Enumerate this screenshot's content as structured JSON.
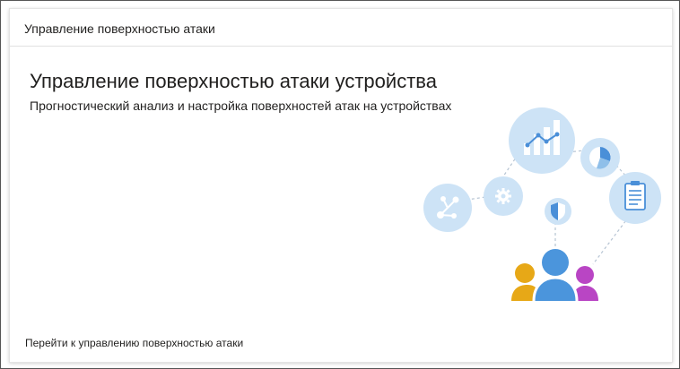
{
  "card": {
    "title": "Управление поверхностью атаки"
  },
  "hero": {
    "title": "Управление поверхностью атаки устройства",
    "subtitle": "Прогностический анализ и настройка поверхностей атак на устройствах"
  },
  "footer": {
    "link_label": "Перейти к управлению поверхностью атаки"
  },
  "colors": {
    "circle_fill": "#cde3f6",
    "icon_blue": "#4a8fd8",
    "icon_white": "#ffffff",
    "person_yellow": "#e7a817",
    "person_blue": "#4b95dc",
    "person_purple": "#b945c4",
    "dashed_line": "#b6c4d3"
  },
  "illustration": {
    "icons": [
      "chart-icon",
      "pie-chart-icon",
      "document-icon",
      "gear-icon",
      "network-icon",
      "shield-icon",
      "people-icon"
    ]
  }
}
